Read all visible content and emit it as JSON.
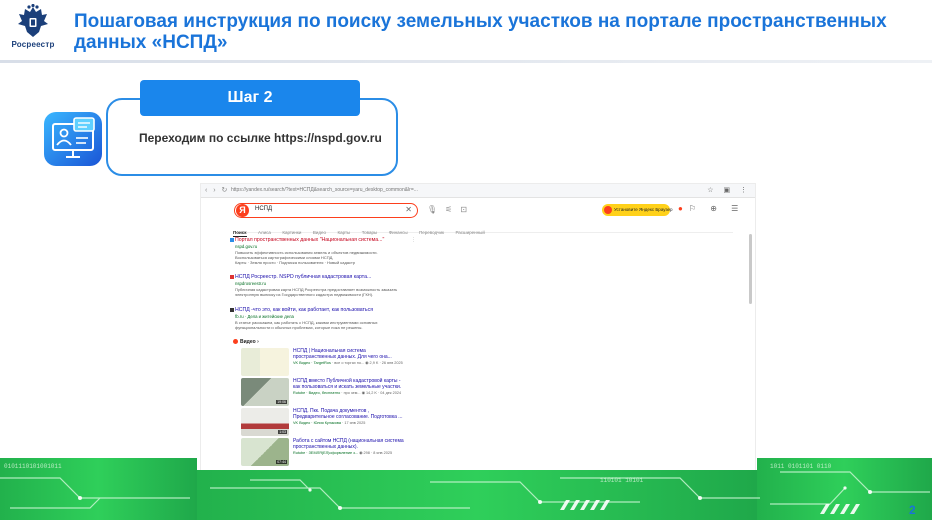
{
  "header": {
    "logo_text": "Росреестр",
    "title": "Пошаговая инструкция по поиску земельных участков на портале пространственных данных «НСПД»"
  },
  "step": {
    "badge": "Шаг 2",
    "text": "Переходим по ссылке https://nspd.gov.ru"
  },
  "browser": {
    "search_value": "НСПД",
    "install_button": "Установите Яндекс Браузер",
    "tabs": [
      "Поиск",
      "Алиса",
      "Картинки",
      "Видео",
      "Карты",
      "Товары",
      "Финансы",
      "Переводчик",
      "Расширенный"
    ],
    "results": [
      {
        "title": "Портал пространственных данных \"Национальная система...\"",
        "site": "nspd.gov.ru",
        "desc1": "Повысить эффективность использования земель и объектов недвижимости.",
        "desc2": "Воспользоваться картографическими слоями НСПД.",
        "desc3": "Карты · Земля просто · Подписка пользователя · Новый кадастр"
      },
      {
        "title": "НСПД Росреестр. NSPD публичная кадастровая карта...",
        "site": "nspdrosreestr.ru",
        "desc1": "Публичная кадастровая карта НСПД Росреестра предоставляет возможность заказать",
        "desc2": "электронную выписку из Государственного кадастра недвижимости (ГКН).",
        "desc3": ""
      },
      {
        "title": "НСПД -что это, как войти, как работает, как пользоваться",
        "site": "fb.ru · Дела и житейские дела",
        "desc1": "В статье расскажем, как работать с НСПД, какими инструментами основных",
        "desc2": "функциональности и обычных проблемах, которые пока не решены.",
        "desc3": ""
      }
    ],
    "video_heading": "Видео",
    "videos": [
      {
        "title1": "НСПД | Национальная система",
        "title2": "пространственных данных. Для чего она...",
        "source": "VK Видео · TargetRos",
        "meta": "· все о торгах по...  ◉ 2,9 K · 26 янв 2025",
        "duration": ""
      },
      {
        "title1": "НСПД вместо Публичной кадастровой карты -",
        "title2": "как пользоваться и искать земельные участки.",
        "source": "Rutube · Видео, бесплатно",
        "meta": "· про зем...  ◉ 14,2 K · 04 дек 2024",
        "duration": "19:06"
      },
      {
        "title1": "НСПД. Пкк. Подача документов ,",
        "title2": "Предварительное согласование. Подготовка ...",
        "source": "VK Видео · Юлия Кулакова",
        "meta": "· 17 янв 2025",
        "duration": "1:03"
      },
      {
        "title1": "Работа с сайтом НСПД (национальная система",
        "title2": "пространственных данных).",
        "source": "Rutube · ЗЕМЛЯ(ЕЛ)оформление з...",
        "meta": "◉ 298 · 8 янв 2025",
        "duration": "07:44"
      }
    ]
  },
  "page_number": "2",
  "colors": {
    "title_blue": "#1a74d9",
    "badge_blue": "#1a86ec",
    "yandex_red": "#fc3f1d",
    "footer_green": "#2fbf4a"
  }
}
